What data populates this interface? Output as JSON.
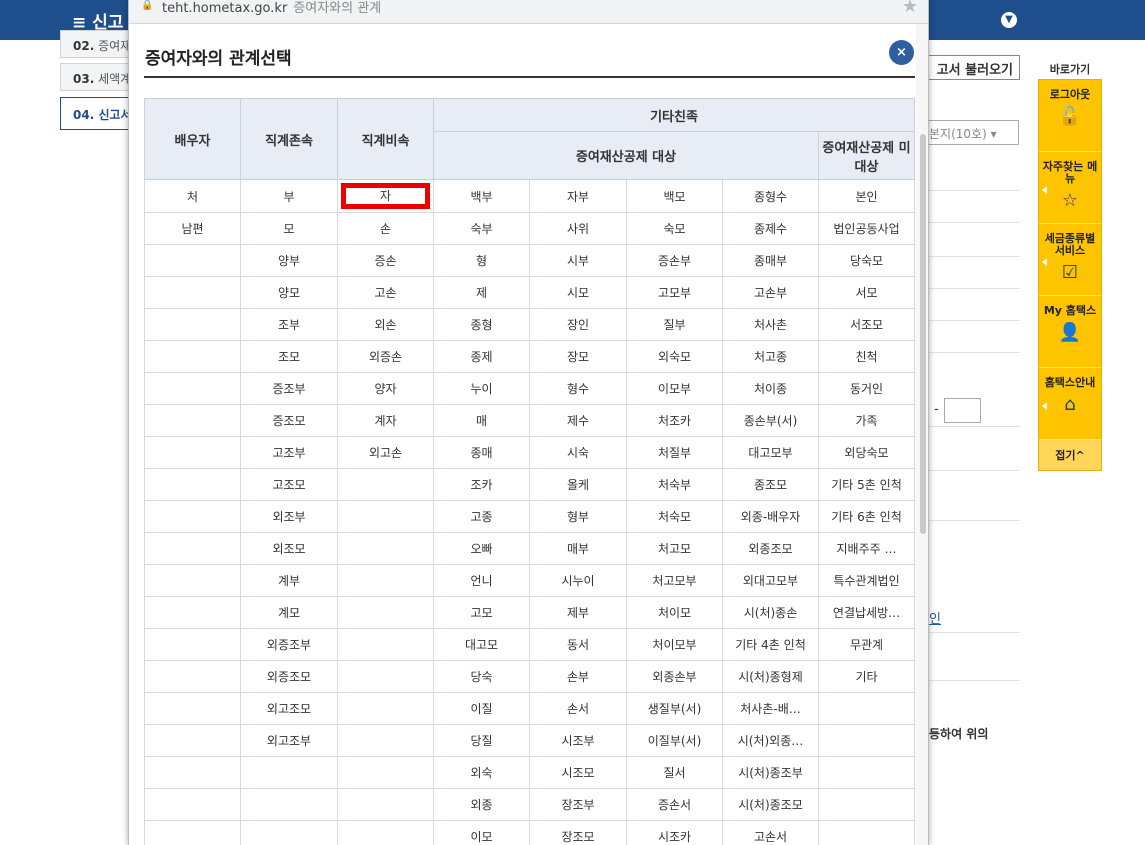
{
  "page": {
    "menu_label": "≡ 신고",
    "steps": [
      {
        "num": "02.",
        "label": "증여재"
      },
      {
        "num": "03.",
        "label": "세액계"
      },
      {
        "num": "04.",
        "label": "신고서"
      }
    ],
    "load_button": "고서 불러오기",
    "select_value": "본지(10호)",
    "dash": "-",
    "link_text": "인",
    "bottom_text": "등하여 위의"
  },
  "quick_menu": {
    "title": "바로가기",
    "items": [
      {
        "label": "로그아웃",
        "icon": "lock-icon"
      },
      {
        "label": "자주찾는 메뉴",
        "icon": "star-icon"
      },
      {
        "label": "세금종류별 서비스",
        "icon": "checkbox-icon"
      },
      {
        "label": "My 홈택스",
        "icon": "person-icon"
      },
      {
        "label": "홈택스안내",
        "icon": "house-icon"
      }
    ],
    "fold_label": "접기^"
  },
  "popup": {
    "url": "teht.hometax.go.kr",
    "window_title": "증여자와의 관계",
    "title": "증여자와의 관계선택",
    "close_label": "×",
    "headers": {
      "spouse": "배우자",
      "lineal_ascendant": "직계존속",
      "lineal_descendant": "직계비속",
      "other_relatives": "기타친족",
      "deduction_target": "증여재산공제 대상",
      "deduction_non_target": "증여재산공제 미대상"
    },
    "selected": {
      "row": 0,
      "col": 2
    },
    "rows": [
      [
        "처",
        "부",
        "자",
        "백부",
        "자부",
        "백모",
        "종형수",
        "본인"
      ],
      [
        "남편",
        "모",
        "손",
        "숙부",
        "사위",
        "숙모",
        "종제수",
        "법인공동사업"
      ],
      [
        "",
        "양부",
        "증손",
        "형",
        "시부",
        "증손부",
        "종매부",
        "당숙모"
      ],
      [
        "",
        "양모",
        "고손",
        "제",
        "시모",
        "고모부",
        "고손부",
        "서모"
      ],
      [
        "",
        "조부",
        "외손",
        "종형",
        "장인",
        "질부",
        "처사촌",
        "서조모"
      ],
      [
        "",
        "조모",
        "외증손",
        "종제",
        "장모",
        "외숙모",
        "처고종",
        "친척"
      ],
      [
        "",
        "증조부",
        "양자",
        "누이",
        "형수",
        "이모부",
        "처이종",
        "동거인"
      ],
      [
        "",
        "증조모",
        "계자",
        "매",
        "제수",
        "처조카",
        "종손부(서)",
        "가족"
      ],
      [
        "",
        "고조부",
        "외고손",
        "종매",
        "시숙",
        "처질부",
        "대고모부",
        "외당숙모"
      ],
      [
        "",
        "고조모",
        "",
        "조카",
        "올케",
        "처숙부",
        "종조모",
        "기타 5촌 인척"
      ],
      [
        "",
        "외조부",
        "",
        "고종",
        "형부",
        "처숙모",
        "외종-배우자",
        "기타 6촌 인척"
      ],
      [
        "",
        "외조모",
        "",
        "오빠",
        "매부",
        "처고모",
        "외종조모",
        "지배주주 …"
      ],
      [
        "",
        "계부",
        "",
        "언니",
        "시누이",
        "처고모부",
        "외대고모부",
        "특수관계법인"
      ],
      [
        "",
        "계모",
        "",
        "고모",
        "제부",
        "처이모",
        "시(처)종손",
        "연결납세방…"
      ],
      [
        "",
        "외증조부",
        "",
        "대고모",
        "동서",
        "처이모부",
        "기타 4촌 인척",
        "무관계"
      ],
      [
        "",
        "외증조모",
        "",
        "당숙",
        "손부",
        "외종손부",
        "시(처)종형제",
        "기타"
      ],
      [
        "",
        "외고조모",
        "",
        "이질",
        "손서",
        "생질부(서)",
        "처사촌-배…",
        ""
      ],
      [
        "",
        "외고조부",
        "",
        "당질",
        "시조부",
        "이질부(서)",
        "시(처)외종…",
        ""
      ],
      [
        "",
        "",
        "",
        "외숙",
        "시조모",
        "질서",
        "시(처)종조부",
        ""
      ],
      [
        "",
        "",
        "",
        "외종",
        "장조부",
        "증손서",
        "시(처)종조모",
        ""
      ],
      [
        "",
        "",
        "",
        "이모",
        "장조모",
        "시조카",
        "고손서",
        ""
      ]
    ]
  }
}
